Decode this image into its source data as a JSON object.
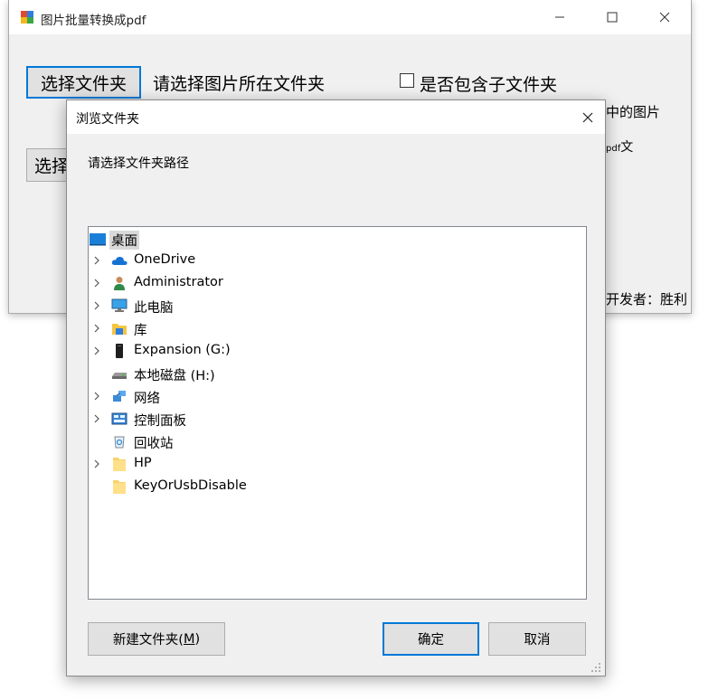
{
  "main_window": {
    "title": "图片批量转换成pdf",
    "select_folder_button": "选择文件夹",
    "select_folder_label": "请选择图片所在文件夹",
    "include_subfolders_checkbox": "是否包含子文件夹",
    "include_subfolders_checked": false,
    "images_label_partial": "中的图片",
    "second_button_partial": "选择",
    "pdf_label_partial_small": "pdf",
    "pdf_label_partial": "文",
    "developer_label_partial": "开发者：胜利"
  },
  "dialog": {
    "title": "浏览文件夹",
    "prompt": "请选择文件夹路径",
    "tree": [
      {
        "label": "桌面",
        "icon": "desktop-icon",
        "expandable": false,
        "selected": true,
        "indent": 0
      },
      {
        "label": "OneDrive",
        "icon": "onedrive-cloud-icon",
        "expandable": true,
        "selected": false,
        "indent": 1
      },
      {
        "label": "Administrator",
        "icon": "user-icon",
        "expandable": true,
        "selected": false,
        "indent": 1
      },
      {
        "label": "此电脑",
        "icon": "computer-icon",
        "expandable": true,
        "selected": false,
        "indent": 1
      },
      {
        "label": "库",
        "icon": "library-icon",
        "expandable": true,
        "selected": false,
        "indent": 1
      },
      {
        "label": "Expansion (G:)",
        "icon": "usb-drive-icon",
        "expandable": true,
        "selected": false,
        "indent": 1
      },
      {
        "label": "本地磁盘 (H:)",
        "icon": "local-disk-icon",
        "expandable": false,
        "selected": false,
        "indent": 1
      },
      {
        "label": "网络",
        "icon": "network-icon",
        "expandable": true,
        "selected": false,
        "indent": 1
      },
      {
        "label": "控制面板",
        "icon": "control-panel-icon",
        "expandable": true,
        "selected": false,
        "indent": 1
      },
      {
        "label": "回收站",
        "icon": "recycle-bin-icon",
        "expandable": false,
        "selected": false,
        "indent": 1
      },
      {
        "label": "HP",
        "icon": "folder-icon",
        "expandable": true,
        "selected": false,
        "indent": 1
      },
      {
        "label": "KeyOrUsbDisable",
        "icon": "folder-icon",
        "expandable": false,
        "selected": false,
        "indent": 1
      }
    ],
    "new_folder_button": "新建文件夹(",
    "new_folder_mnemonic": "M",
    "new_folder_button_end": ")",
    "ok_button": "确定",
    "cancel_button": "取消"
  },
  "colors": {
    "accent": "#0078d7",
    "window_bg": "#f0f0f0",
    "button_bg": "#e1e1e1",
    "selection_bg": "#d9d9d9"
  }
}
